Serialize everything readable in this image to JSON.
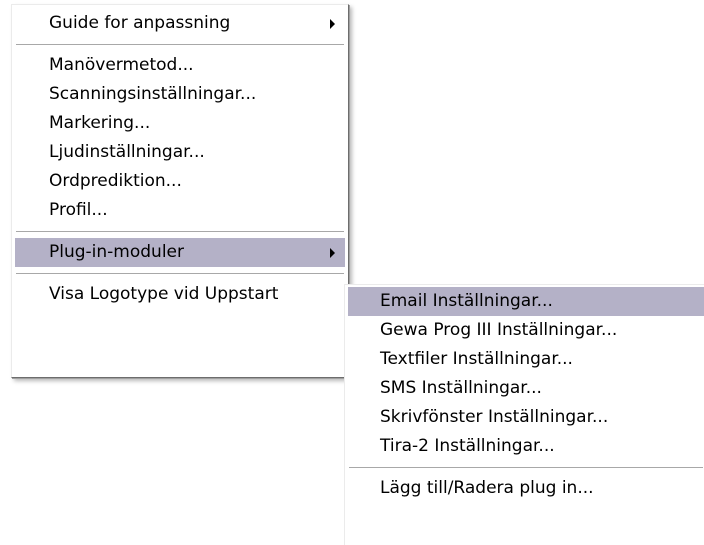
{
  "colors": {
    "highlight": "#b4b1c7"
  },
  "main_menu": {
    "items": [
      {
        "label": "Guide for anpassning",
        "submenu": true
      },
      {
        "label": "Manövermetod..."
      },
      {
        "label": "Scanningsinställningar..."
      },
      {
        "label": "Markering..."
      },
      {
        "label": "Ljudinställningar..."
      },
      {
        "label": "Ordprediktion..."
      },
      {
        "label": "Profil..."
      },
      {
        "label": "Plug-in-moduler",
        "submenu": true,
        "highlighted": true
      },
      {
        "label": "Visa Logotype vid Uppstart"
      }
    ]
  },
  "sub_menu": {
    "items": [
      {
        "label": "Email Inställningar...",
        "highlighted": true
      },
      {
        "label": "Gewa Prog III Inställningar..."
      },
      {
        "label": "Textfiler Inställningar..."
      },
      {
        "label": "SMS Inställningar..."
      },
      {
        "label": "Skrivfönster Inställningar..."
      },
      {
        "label": "Tira-2 Inställningar..."
      },
      {
        "label": "Lägg till/Radera plug in..."
      }
    ]
  }
}
